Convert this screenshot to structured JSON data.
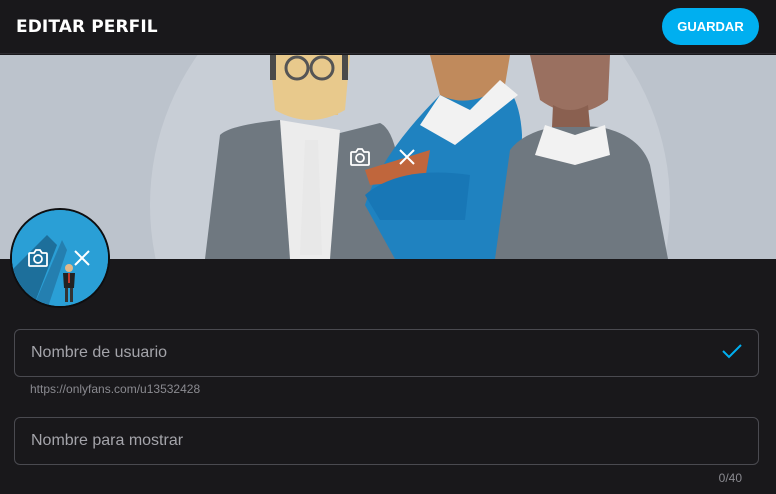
{
  "header": {
    "title": "EDITAR PERFIL",
    "save_label": "GUARDAR"
  },
  "cover": {
    "camera_icon": "camera-icon",
    "remove_icon": "close-icon"
  },
  "avatar": {
    "camera_icon": "camera-icon",
    "remove_icon": "close-icon"
  },
  "form": {
    "username": {
      "placeholder": "Nombre de usuario",
      "value": "",
      "helper": "https://onlyfans.com/u13532428"
    },
    "display_name": {
      "placeholder": "Nombre para mostrar",
      "value": "",
      "counter": "0/40"
    }
  },
  "colors": {
    "accent": "#00aff0",
    "background": "#19181b",
    "border": "#4a4a50"
  }
}
